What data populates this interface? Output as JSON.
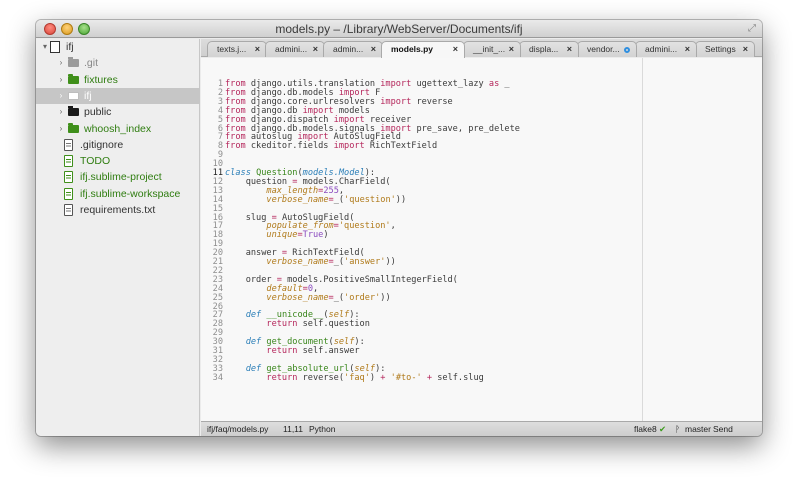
{
  "window": {
    "title": "models.py – /Library/WebServer/Documents/ifj"
  },
  "sidebar": {
    "items": [
      {
        "label": "ifj",
        "kind": "project",
        "arrow": "▾"
      },
      {
        "label": ".git",
        "kind": "folder-grey",
        "arrow": "›"
      },
      {
        "label": "fixtures",
        "kind": "folder-green",
        "arrow": "›"
      },
      {
        "label": "ifj",
        "kind": "folder-white",
        "arrow": "›",
        "selected": true
      },
      {
        "label": "public",
        "kind": "folder-black",
        "arrow": "›"
      },
      {
        "label": "whoosh_index",
        "kind": "folder-green",
        "arrow": "›"
      },
      {
        "label": ".gitignore",
        "kind": "file"
      },
      {
        "label": "TODO",
        "kind": "file-green"
      },
      {
        "label": "ifj.sublime-project",
        "kind": "file-green"
      },
      {
        "label": "ifj.sublime-workspace",
        "kind": "file-green"
      },
      {
        "label": "requirements.txt",
        "kind": "file"
      }
    ]
  },
  "tabs": [
    {
      "label": "texts.j...",
      "close": "×"
    },
    {
      "label": "admini...",
      "close": "×"
    },
    {
      "label": "admin...",
      "close": "×"
    },
    {
      "label": "models.py",
      "close": "×",
      "active": true
    },
    {
      "label": "__init_...",
      "close": "×"
    },
    {
      "label": "displa...",
      "close": "×"
    },
    {
      "label": "vendor...",
      "dirty": true
    },
    {
      "label": "admini...",
      "close": "×"
    },
    {
      "label": "Settings",
      "close": "×"
    }
  ],
  "editor": {
    "current_line": 11,
    "line_numbers": [
      "1",
      "2",
      "3",
      "4",
      "5",
      "6",
      "7",
      "8",
      "9",
      "10",
      "11",
      "12",
      "13",
      "14",
      "15",
      "16",
      "17",
      "18",
      "19",
      "20",
      "21",
      "22",
      "23",
      "24",
      "25",
      "26",
      "27",
      "28",
      "29",
      "30",
      "31",
      "32",
      "33",
      "34"
    ],
    "lines": [
      [
        [
          "kw",
          "from"
        ],
        [
          "pl",
          " django.utils.translation "
        ],
        [
          "kw",
          "import"
        ],
        [
          "pl",
          " ugettext_lazy "
        ],
        [
          "kw",
          "as"
        ],
        [
          "pl",
          " _"
        ]
      ],
      [
        [
          "kw",
          "from"
        ],
        [
          "pl",
          " django.db.models "
        ],
        [
          "kw",
          "import"
        ],
        [
          "pl",
          " F"
        ]
      ],
      [
        [
          "kw",
          "from"
        ],
        [
          "pl",
          " django.core.urlresolvers "
        ],
        [
          "kw",
          "import"
        ],
        [
          "pl",
          " reverse"
        ]
      ],
      [
        [
          "kw",
          "from"
        ],
        [
          "pl",
          " django.db "
        ],
        [
          "kw",
          "import"
        ],
        [
          "pl",
          " models"
        ]
      ],
      [
        [
          "kw",
          "from"
        ],
        [
          "pl",
          " django.dispatch "
        ],
        [
          "kw",
          "import"
        ],
        [
          "pl",
          " receiver"
        ]
      ],
      [
        [
          "kw",
          "from"
        ],
        [
          "pl",
          " django.db.models.signals "
        ],
        [
          "kw",
          "import"
        ],
        [
          "pl",
          " pre_save, pre_delete"
        ]
      ],
      [
        [
          "kw",
          "from"
        ],
        [
          "pl",
          " autoslug "
        ],
        [
          "kw",
          "import"
        ],
        [
          "pl",
          " AutoSlugField"
        ]
      ],
      [
        [
          "kw",
          "from"
        ],
        [
          "pl",
          " ckeditor.fields "
        ],
        [
          "kw",
          "import"
        ],
        [
          "pl",
          " RichTextField"
        ]
      ],
      [],
      [],
      [
        [
          "cls",
          "class"
        ],
        [
          "pl",
          " "
        ],
        [
          "fn",
          "Question"
        ],
        [
          "pl",
          "("
        ],
        [
          "cls",
          "models.Model"
        ],
        [
          "pl",
          "):"
        ]
      ],
      [
        [
          "pl",
          "    question "
        ],
        [
          "kw",
          "="
        ],
        [
          "pl",
          " models.CharField("
        ]
      ],
      [
        [
          "pl",
          "        "
        ],
        [
          "kwarg",
          "max_length"
        ],
        [
          "kw",
          "="
        ],
        [
          "nm",
          "255"
        ],
        [
          "pl",
          ","
        ]
      ],
      [
        [
          "pl",
          "        "
        ],
        [
          "kwarg",
          "verbose_name"
        ],
        [
          "kw",
          "="
        ],
        [
          "pl",
          "_("
        ],
        [
          "st",
          "'question'"
        ],
        [
          "pl",
          "))"
        ]
      ],
      [],
      [
        [
          "pl",
          "    slug "
        ],
        [
          "kw",
          "="
        ],
        [
          "pl",
          " AutoSlugField("
        ]
      ],
      [
        [
          "pl",
          "        "
        ],
        [
          "kwarg",
          "populate_from"
        ],
        [
          "kw",
          "="
        ],
        [
          "st",
          "'question'"
        ],
        [
          "pl",
          ","
        ]
      ],
      [
        [
          "pl",
          "        "
        ],
        [
          "kwarg",
          "unique"
        ],
        [
          "kw",
          "="
        ],
        [
          "nm",
          "True"
        ],
        [
          "pl",
          ")"
        ]
      ],
      [],
      [
        [
          "pl",
          "    answer "
        ],
        [
          "kw",
          "="
        ],
        [
          "pl",
          " RichTextField("
        ]
      ],
      [
        [
          "pl",
          "        "
        ],
        [
          "kwarg",
          "verbose_name"
        ],
        [
          "kw",
          "="
        ],
        [
          "pl",
          "_("
        ],
        [
          "st",
          "'answer'"
        ],
        [
          "pl",
          "))"
        ]
      ],
      [],
      [
        [
          "pl",
          "    order "
        ],
        [
          "kw",
          "="
        ],
        [
          "pl",
          " models.PositiveSmallIntegerField("
        ]
      ],
      [
        [
          "pl",
          "        "
        ],
        [
          "kwarg",
          "default"
        ],
        [
          "kw",
          "="
        ],
        [
          "nm",
          "0"
        ],
        [
          "pl",
          ","
        ]
      ],
      [
        [
          "pl",
          "        "
        ],
        [
          "kwarg",
          "verbose_name"
        ],
        [
          "kw",
          "="
        ],
        [
          "pl",
          "_("
        ],
        [
          "st",
          "'order'"
        ],
        [
          "pl",
          "))"
        ]
      ],
      [],
      [
        [
          "pl",
          "    "
        ],
        [
          "cls",
          "def"
        ],
        [
          "pl",
          " "
        ],
        [
          "fn",
          "__unicode__"
        ],
        [
          "pl",
          "("
        ],
        [
          "selfc",
          "self"
        ],
        [
          "pl",
          "):"
        ]
      ],
      [
        [
          "pl",
          "        "
        ],
        [
          "kw",
          "return"
        ],
        [
          "pl",
          " self.question"
        ]
      ],
      [],
      [
        [
          "pl",
          "    "
        ],
        [
          "cls",
          "def"
        ],
        [
          "pl",
          " "
        ],
        [
          "fn",
          "get_document"
        ],
        [
          "pl",
          "("
        ],
        [
          "selfc",
          "self"
        ],
        [
          "pl",
          "):"
        ]
      ],
      [
        [
          "pl",
          "        "
        ],
        [
          "kw",
          "return"
        ],
        [
          "pl",
          " self.answer"
        ]
      ],
      [],
      [
        [
          "pl",
          "    "
        ],
        [
          "cls",
          "def"
        ],
        [
          "pl",
          " "
        ],
        [
          "fn",
          "get_absolute_url"
        ],
        [
          "pl",
          "("
        ],
        [
          "selfc",
          "self"
        ],
        [
          "pl",
          "):"
        ]
      ],
      [
        [
          "pl",
          "        "
        ],
        [
          "kw",
          "return"
        ],
        [
          "pl",
          " reverse("
        ],
        [
          "st",
          "'faq'"
        ],
        [
          "pl",
          ") "
        ],
        [
          "kw",
          "+"
        ],
        [
          "pl",
          " "
        ],
        [
          "st",
          "'#to-'"
        ],
        [
          "pl",
          " "
        ],
        [
          "kw",
          "+"
        ],
        [
          "pl",
          " self.slug"
        ]
      ]
    ]
  },
  "statusbar": {
    "path": "ifj/faq/models.py",
    "position": "11,11",
    "syntax": "Python",
    "lint": "flake8",
    "lint_ok": "✔",
    "branch_icon": "ᚹ",
    "branch": "master",
    "feedback": "Send Feedback"
  }
}
